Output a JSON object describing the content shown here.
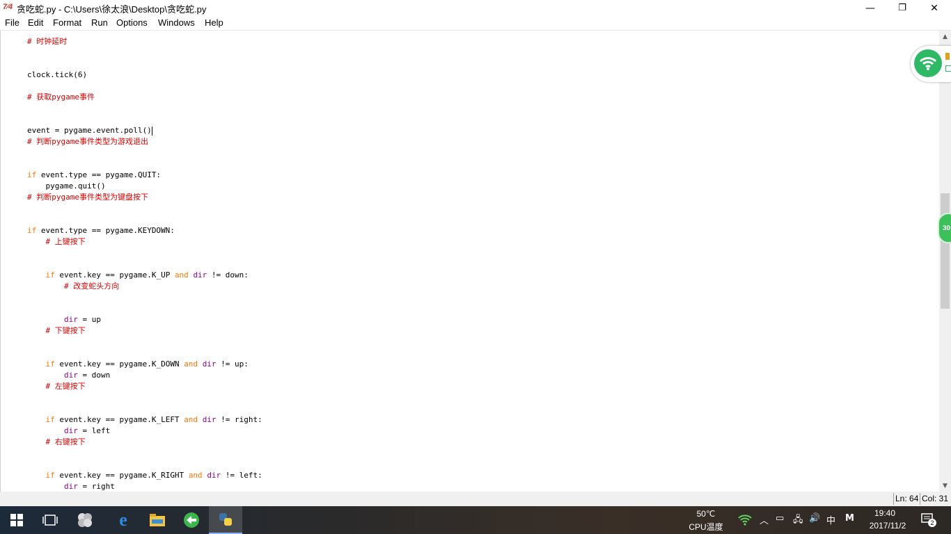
{
  "window": {
    "app_icon": "7⁄4",
    "title": "贪吃蛇.py - C:\\Users\\徐太浪\\Desktop\\贪吃蛇.py",
    "minimize": "—",
    "restore": "❐",
    "close": "✕"
  },
  "menu": [
    "File",
    "Edit",
    "Format",
    "Run",
    "Options",
    "Windows",
    "Help"
  ],
  "code_lines": [
    {
      "segments": [
        {
          "t": "# 时钟延时",
          "c": "cm"
        }
      ]
    },
    {
      "segments": [
        {
          "t": "clock.tick(6)",
          "c": ""
        }
      ]
    },
    {
      "segments": [
        {
          "t": "# 获取pygame事件",
          "c": "cm"
        }
      ]
    },
    {
      "segments": [
        {
          "t": "event = pygame.event.poll()",
          "c": ""
        }
      ],
      "caret": true
    },
    {
      "segments": [
        {
          "t": "# 判断pygame事件类型为游戏退出",
          "c": "cm"
        }
      ]
    },
    {
      "segments": [
        {
          "t": "if",
          "c": "kw"
        },
        {
          "t": " event.type == pygame.QUIT:",
          "c": ""
        }
      ]
    },
    {
      "segments": [
        {
          "t": "    pygame.quit()",
          "c": ""
        }
      ]
    },
    {
      "segments": [
        {
          "t": "# 判断pygame事件类型为键盘按下",
          "c": "cm"
        }
      ]
    },
    {
      "segments": [
        {
          "t": "if",
          "c": "kw"
        },
        {
          "t": " event.type == pygame.KEYDOWN:",
          "c": ""
        }
      ]
    },
    {
      "segments": [
        {
          "t": "    ",
          "c": ""
        },
        {
          "t": "# 上键按下",
          "c": "cm"
        }
      ]
    },
    {
      "segments": [
        {
          "t": "    ",
          "c": ""
        },
        {
          "t": "if",
          "c": "kw"
        },
        {
          "t": " event.key == pygame.K_UP ",
          "c": ""
        },
        {
          "t": "and",
          "c": "kw"
        },
        {
          "t": " ",
          "c": ""
        },
        {
          "t": "dir",
          "c": "bi"
        },
        {
          "t": " != down:",
          "c": ""
        }
      ]
    },
    {
      "segments": [
        {
          "t": "        ",
          "c": ""
        },
        {
          "t": "# 改变蛇头方向",
          "c": "cm"
        }
      ]
    },
    {
      "segments": [
        {
          "t": "        ",
          "c": ""
        },
        {
          "t": "dir",
          "c": "bi"
        },
        {
          "t": " = up",
          "c": ""
        }
      ]
    },
    {
      "segments": [
        {
          "t": "    ",
          "c": ""
        },
        {
          "t": "# 下键按下",
          "c": "cm"
        }
      ]
    },
    {
      "segments": [
        {
          "t": "    ",
          "c": ""
        },
        {
          "t": "if",
          "c": "kw"
        },
        {
          "t": " event.key == pygame.K_DOWN ",
          "c": ""
        },
        {
          "t": "and",
          "c": "kw"
        },
        {
          "t": " ",
          "c": ""
        },
        {
          "t": "dir",
          "c": "bi"
        },
        {
          "t": " != up:",
          "c": ""
        }
      ]
    },
    {
      "segments": [
        {
          "t": "        ",
          "c": ""
        },
        {
          "t": "dir",
          "c": "bi"
        },
        {
          "t": " = down",
          "c": ""
        }
      ]
    },
    {
      "segments": [
        {
          "t": "    ",
          "c": ""
        },
        {
          "t": "# 左键按下",
          "c": "cm"
        }
      ]
    },
    {
      "segments": [
        {
          "t": "    ",
          "c": ""
        },
        {
          "t": "if",
          "c": "kw"
        },
        {
          "t": " event.key == pygame.K_LEFT ",
          "c": ""
        },
        {
          "t": "and",
          "c": "kw"
        },
        {
          "t": " ",
          "c": ""
        },
        {
          "t": "dir",
          "c": "bi"
        },
        {
          "t": " != right:",
          "c": ""
        }
      ]
    },
    {
      "segments": [
        {
          "t": "        ",
          "c": ""
        },
        {
          "t": "dir",
          "c": "bi"
        },
        {
          "t": " = left",
          "c": ""
        }
      ]
    },
    {
      "segments": [
        {
          "t": "    ",
          "c": ""
        },
        {
          "t": "# 右键按下",
          "c": "cm"
        }
      ]
    },
    {
      "segments": [
        {
          "t": "    ",
          "c": ""
        },
        {
          "t": "if",
          "c": "kw"
        },
        {
          "t": " event.key == pygame.K_RIGHT ",
          "c": ""
        },
        {
          "t": "and",
          "c": "kw"
        },
        {
          "t": " ",
          "c": ""
        },
        {
          "t": "dir",
          "c": "bi"
        },
        {
          "t": " != left:",
          "c": ""
        }
      ]
    },
    {
      "segments": [
        {
          "t": "        ",
          "c": ""
        },
        {
          "t": "dir",
          "c": "bi"
        },
        {
          "t": " = right",
          "c": ""
        }
      ]
    }
  ],
  "syntax_colors": {
    "keyword": "#ff7700",
    "builtin": "#900090",
    "comment": "#dd0000"
  },
  "overlays": {
    "green_ball_text": "30"
  },
  "status": {
    "line": "Ln: 64",
    "col": "Col: 31"
  },
  "taskbar": {
    "icons": [
      "windows-start-icon",
      "task-view-icon",
      "app-icon",
      "edge-icon",
      "file-explorer-icon",
      "browser-icon",
      "python-idle-icon"
    ],
    "cpu_temp": "50℃",
    "cpu_label": "CPU温度",
    "ime": "中",
    "ime_mode": "M",
    "time": "19:40",
    "date": "2017/11/2",
    "notification_count": "2"
  }
}
